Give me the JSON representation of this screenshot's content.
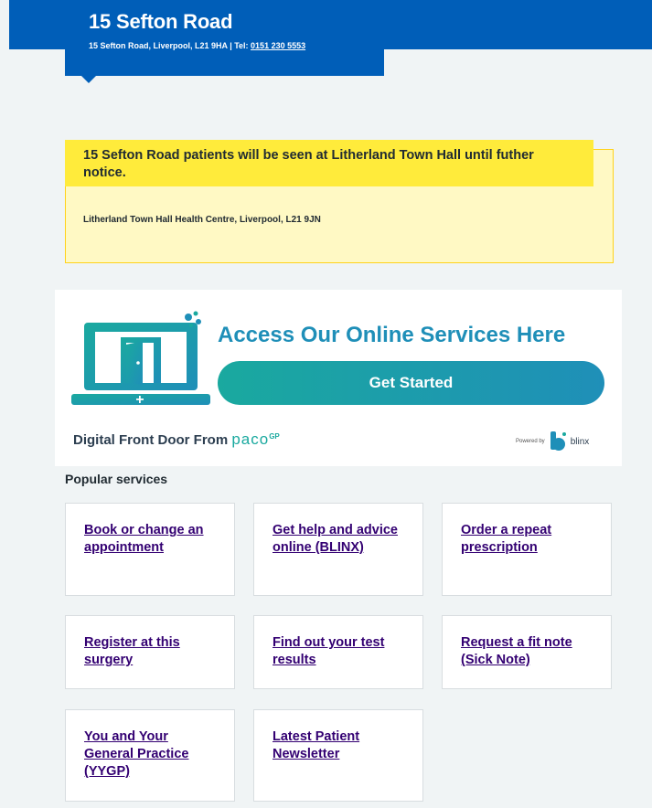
{
  "header": {
    "practice_name": "15 Sefton Road",
    "address": "15 Sefton Road, Liverpool, L21 9HA | Tel: ",
    "phone": "0151 230 5553"
  },
  "notice": {
    "heading": "15 Sefton Road patients will be seen at Litherland Town Hall until futher notice.",
    "body": "Litherland Town Hall Health Centre, Liverpool, L21 9JN"
  },
  "banner": {
    "headline": "Access Our Online Services Here",
    "button_label": "Get Started",
    "footer_prefix": "Digital Front Door From ",
    "brand": "paco",
    "brand_suffix": "GP",
    "powered_by": "Powered by",
    "powered_brand": "blinx",
    "icon": "laptop-door-icon",
    "colors": {
      "teal": "#1aa99f",
      "blue": "#1f8fb8"
    }
  },
  "popular": {
    "heading": "Popular services",
    "services": [
      {
        "label": "Book or change an appointment"
      },
      {
        "label": "Get help and advice online (BLINX)"
      },
      {
        "label": "Order a repeat prescription"
      },
      {
        "label": "Register at this surgery"
      },
      {
        "label": "Find out your test results"
      },
      {
        "label": "Request a fit note (Sick Note)"
      },
      {
        "label": "You and Your General Practice (YYGP)"
      },
      {
        "label": "Latest Patient Newsletter"
      }
    ]
  },
  "colors": {
    "nhs_blue": "#005eb8",
    "notice_yellow": "#ffeb3b",
    "link_purple": "#330072",
    "page_bg": "#f0f4f5"
  }
}
